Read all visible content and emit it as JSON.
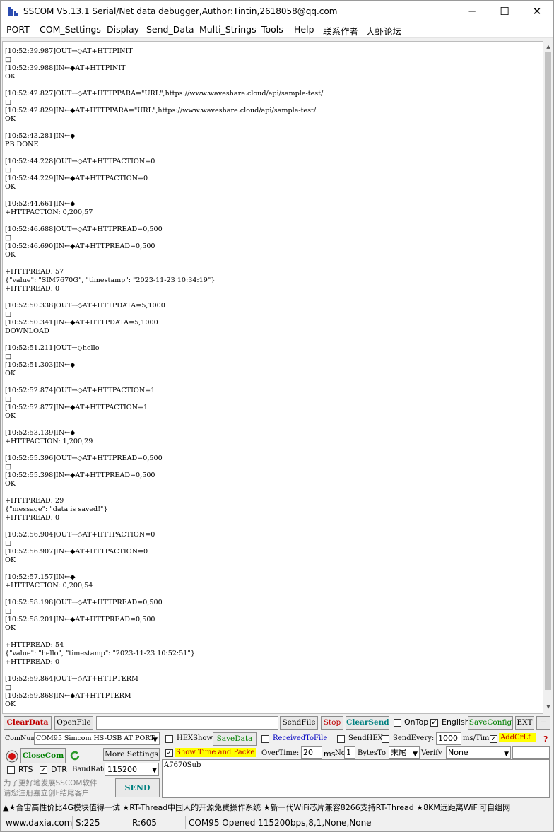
{
  "window": {
    "title": "SSCOM V5.13.1 Serial/Net data debugger,Author:Tintin,2618058@qq.com",
    "minimize_glyph": "─",
    "maximize_glyph": "☐",
    "close_glyph": "✕"
  },
  "menu": [
    {
      "label": "PORT"
    },
    {
      "label": "COM_Settings"
    },
    {
      "label": "Display"
    },
    {
      "label": "Send_Data"
    },
    {
      "label": "Multi_Strings"
    },
    {
      "label": "Tools"
    },
    {
      "label": "Help"
    },
    {
      "label": "联系作者"
    },
    {
      "label": "大虾论坛"
    }
  ],
  "terminal": {
    "lines": [
      "[10:52:39.987]OUT→◇AT+HTTPINIT",
      "□",
      "[10:52:39.988]IN←◆AT+HTTPINIT",
      "OK",
      "",
      "[10:52:42.827]OUT→◇AT+HTTPPARA=\"URL\",https://www.waveshare.cloud/api/sample-test/",
      "□",
      "[10:52:42.829]IN←◆AT+HTTPPARA=\"URL\",https://www.waveshare.cloud/api/sample-test/",
      "OK",
      "",
      "[10:52:43.281]IN←◆",
      "PB DONE",
      "",
      "[10:52:44.228]OUT→◇AT+HTTPACTION=0",
      "□",
      "[10:52:44.229]IN←◆AT+HTTPACTION=0",
      "OK",
      "",
      "[10:52:44.661]IN←◆",
      "+HTTPACTION: 0,200,57",
      "",
      "[10:52:46.688]OUT→◇AT+HTTPREAD=0,500",
      "□",
      "[10:52:46.690]IN←◆AT+HTTPREAD=0,500",
      "OK",
      "",
      "+HTTPREAD: 57",
      "{\"value\": \"SIM7670G\", \"timestamp\": \"2023-11-23 10:34:19\"}",
      "+HTTPREAD: 0",
      "",
      "[10:52:50.338]OUT→◇AT+HTTPDATA=5,1000",
      "□",
      "[10:52:50.341]IN←◆AT+HTTPDATA=5,1000",
      "DOWNLOAD",
      "",
      "[10:52:51.211]OUT→◇hello",
      "□",
      "[10:52:51.303]IN←◆",
      "OK",
      "",
      "[10:52:52.874]OUT→◇AT+HTTPACTION=1",
      "□",
      "[10:52:52.877]IN←◆AT+HTTPACTION=1",
      "OK",
      "",
      "[10:52:53.139]IN←◆",
      "+HTTPACTION: 1,200,29",
      "",
      "[10:52:55.396]OUT→◇AT+HTTPREAD=0,500",
      "□",
      "[10:52:55.398]IN←◆AT+HTTPREAD=0,500",
      "OK",
      "",
      "+HTTPREAD: 29",
      "{\"message\": \"data is saved!\"}",
      "+HTTPREAD: 0",
      "",
      "[10:52:56.904]OUT→◇AT+HTTPACTION=0",
      "□",
      "[10:52:56.907]IN←◆AT+HTTPACTION=0",
      "OK",
      "",
      "[10:52:57.157]IN←◆",
      "+HTTPACTION: 0,200,54",
      "",
      "[10:52:58.198]OUT→◇AT+HTTPREAD=0,500",
      "□",
      "[10:52:58.201]IN←◆AT+HTTPREAD=0,500",
      "OK",
      "",
      "+HTTPREAD: 54",
      "{\"value\": \"hello\", \"timestamp\": \"2023-11-23 10:52:51\"}",
      "+HTTPREAD: 0",
      "",
      "[10:52:59.864]OUT→◇AT+HTTPTERM",
      "□",
      "[10:52:59.868]IN←◆AT+HTTPTERM",
      "OK"
    ]
  },
  "toolbar": {
    "clear_data": "ClearData",
    "open_file": "OpenFile",
    "file_path": "",
    "send_file": "SendFile",
    "stop": "Stop",
    "clear_send": "ClearSend",
    "on_top": "OnTop",
    "english": "English",
    "save_config": "SaveConfig",
    "ext": "EXT",
    "minus": "─"
  },
  "controls": {
    "comnum_label": "ComNum",
    "comnum_value": "COM95 Simcom HS-USB AT PORT",
    "close_com": "CloseCom",
    "more_settings": "More Settings",
    "rts": "RTS",
    "dtr": "DTR",
    "baud_label": "BaudRate:",
    "baud_value": "115200",
    "hex_show": "HEXShow",
    "save_data": "SaveData",
    "received_to_file": "ReceivedToFile",
    "send_hex": "SendHEX",
    "send_every": "SendEvery:",
    "send_every_value": "1000",
    "send_every_unit": "ms/Tim",
    "add_crlf": "AddCrLf",
    "show_time": "Show Time and Packe",
    "overtime_label": "OverTime:",
    "overtime_value": "20",
    "overtime_unit": "ms",
    "no_label": "No",
    "no_value": "1",
    "bytes_to_label": "BytesTo",
    "bytes_to_value": "末尾",
    "verify_label": "Verify",
    "verify_value": "None",
    "promo_line1": "为了更好地发展SSCOM软件",
    "promo_line2": "请您注册嘉立创F结尾客户",
    "send_button": "SEND",
    "send_text": "A7670Sub"
  },
  "adbar": {
    "text": "▲★合宙高性价比4G模块值得一试 ★RT-Thread中国人的开源免费操作系统 ★新一代WiFi芯片兼容8266支持RT-Thread ★8KM远距离WiFi可自组网"
  },
  "status": {
    "website": "www.daxia.com",
    "sent": "S:225",
    "received": "R:605",
    "port_state": "COM95 Opened  115200bps,8,1,None,None"
  },
  "colors": {
    "red_label": "#c00000",
    "green_label": "#008000",
    "blue_label": "#0000c0",
    "highlight_yellow": "#ffff00",
    "status_red": "#d01010"
  }
}
